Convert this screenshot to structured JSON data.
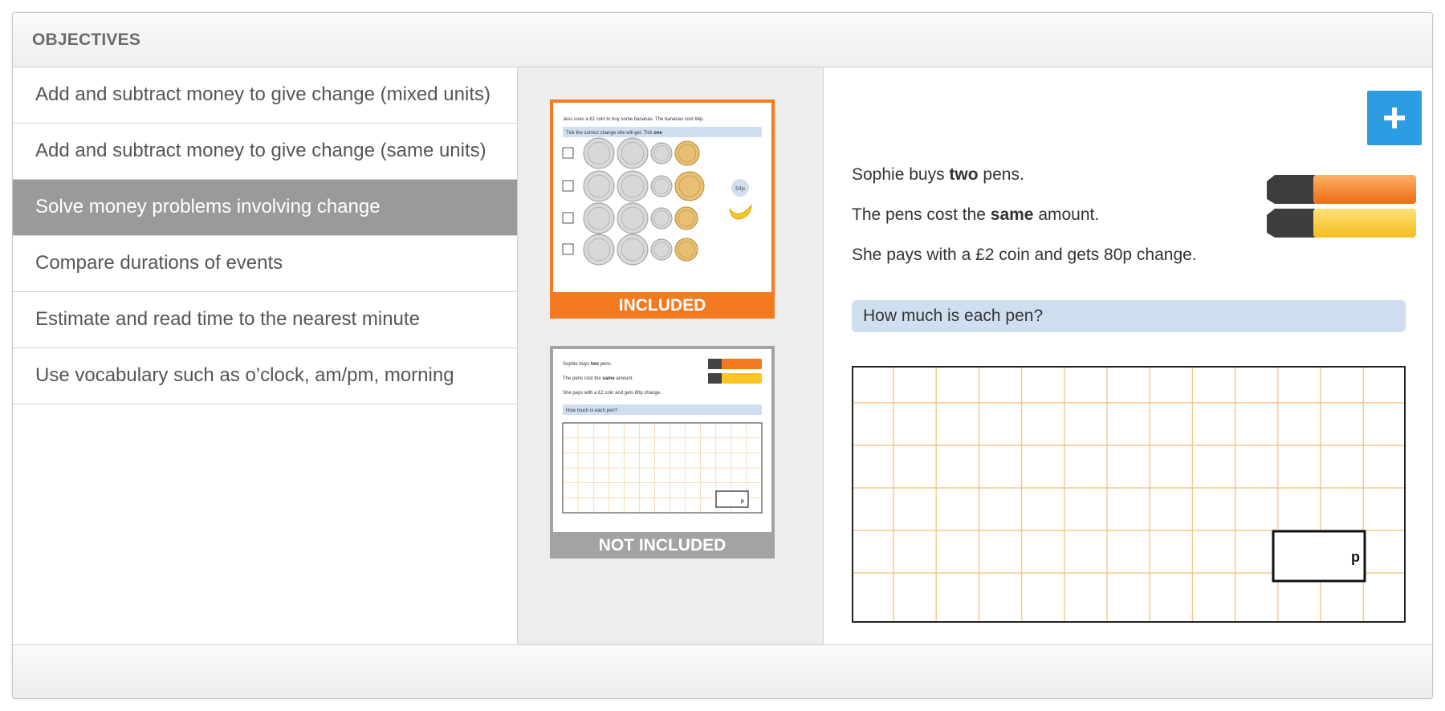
{
  "header": {
    "title": "OBJECTIVES"
  },
  "objectives": [
    {
      "label": "Add and subtract money to give change (mixed units)",
      "selected": false
    },
    {
      "label": "Add and subtract money to give change (same units)",
      "selected": false
    },
    {
      "label": "Solve money problems involving change",
      "selected": true
    },
    {
      "label": "Compare durations of events",
      "selected": false
    },
    {
      "label": "Estimate and read time to the nearest minute",
      "selected": false
    },
    {
      "label": "Use vocabulary such as o’clock, am/pm, morning",
      "selected": false
    }
  ],
  "thumbnails": {
    "included": {
      "label": "INCLUDED",
      "q1": "Jess uses a £1 coin to buy some bananas. The bananas cost 64p.",
      "q2_prefix": "Tick the correct change she will get. Tick ",
      "q2_bold": "one",
      "price_tag": "64p",
      "color": "#f47a21"
    },
    "not_included": {
      "label": "NOT INCLUDED",
      "color": "#a3a3a3"
    }
  },
  "preview": {
    "add_button": "+",
    "line1": {
      "pre": "Sophie buys ",
      "bold": "two",
      "post": " pens."
    },
    "line2": {
      "pre": "The pens cost the ",
      "bold": "same",
      "post": " amount."
    },
    "line3": "She pays with a £2 coin and gets 80p change.",
    "question": "How much is each pen?",
    "answer_unit": "p",
    "colors": {
      "grid": "#f7c98a",
      "question_bg": "#cfdff0",
      "add_button": "#2d9de3",
      "pen1": "#f47a21",
      "pen2": "#f9c623"
    }
  }
}
